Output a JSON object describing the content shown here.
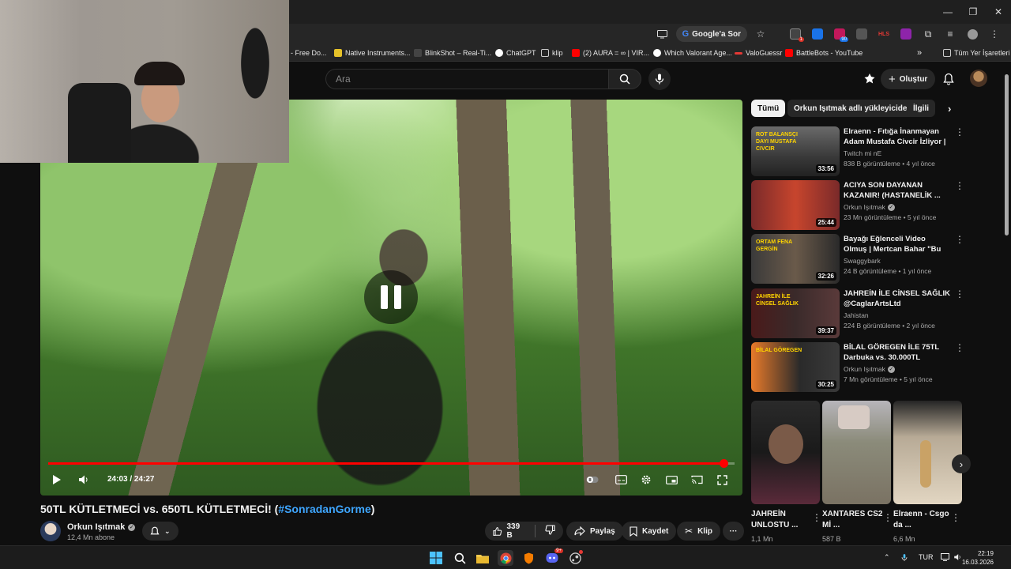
{
  "browser": {
    "window_controls": [
      "—",
      "❐",
      "✕"
    ],
    "omnibox_actions": {
      "google_ask": "Google'a Sor"
    },
    "bookmarks": [
      {
        "label": "- Free Do..."
      },
      {
        "label": "Native Instruments..."
      },
      {
        "label": "BlinkShot – Real-Ti..."
      },
      {
        "label": "ChatGPT"
      },
      {
        "label": "klip"
      },
      {
        "label": "(2) AURA = ∞ | VIR..."
      },
      {
        "label": "Which Valorant Age..."
      },
      {
        "label": "ValoGuessr"
      },
      {
        "label": "BattleBots - YouTube"
      }
    ],
    "bookmarks_overflow": "»",
    "all_bookmarks": "Tüm Yer İşaretleri"
  },
  "header": {
    "search_placeholder": "Ara",
    "create_label": "Oluştur"
  },
  "player": {
    "time": "24:03 / 24:27",
    "progress_fraction": 0.984
  },
  "video": {
    "title_main": "50TL KÜTLETMECİ vs. 650TL KÜTLETMECİ! (",
    "title_tag": "#SonradanGorme",
    "title_end": ")",
    "channel": "Orkun Işıtmak",
    "subscribers": "12,4 Mn abone",
    "likes": "339 B",
    "share": "Paylaş",
    "save": "Kaydet",
    "clip": "Klip",
    "more": "···"
  },
  "chips": [
    "Tümü",
    "Orkun Işıtmak adlı yükleyiciden",
    "İlgili"
  ],
  "recommendations": [
    {
      "title": "Elraenn - Fıtığa İnanmayan Adam Mustafa Civcir İzliyor | ...",
      "channel": "Twitch mi nE",
      "verified": false,
      "meta": "838 B görüntüleme • 4 yıl önce",
      "duration": "33:56",
      "thumb_text": "ROT BALANSÇI DAYI MUSTAFA CIVCIR"
    },
    {
      "title": "ACIYA SON DAYANAN KAZANIR! (HASTANELİK ...",
      "channel": "Orkun Işıtmak",
      "verified": true,
      "meta": "23 Mn görüntüleme • 5 yıl önce",
      "duration": "25:44",
      "thumb_text": ""
    },
    {
      "title": "Bayağı Eğlenceli Video Olmuş | Mertcan Bahar \"Bu işin dönüş...",
      "channel": "Swaggybark",
      "verified": false,
      "meta": "24 B görüntüleme • 1 yıl önce",
      "duration": "32:26",
      "thumb_text": "ORTAM FENA GERGİN"
    },
    {
      "title": "JAHREİN İLE CİNSEL SAĞLIK @CaglarArtsLtd",
      "channel": "Jahistan",
      "verified": false,
      "meta": "224 B görüntüleme • 2 yıl önce",
      "duration": "39:37",
      "thumb_text": "JAHREİN İLE CİNSEL SAĞLIK"
    },
    {
      "title": "BİLAL GÖREGEN İLE 75TL Darbuka vs. 30.000TL Darbuk...",
      "channel": "Orkun Işıtmak",
      "verified": true,
      "meta": "7 Mn görüntüleme • 5 yıl önce",
      "duration": "30:25",
      "thumb_text": "BİLAL GÖREGEN"
    }
  ],
  "shorts": [
    {
      "title": "JAHREİN UNLOSTU ...",
      "views": "1,1 Mn"
    },
    {
      "title": "XANTARES CS2 Mİ ...",
      "views": "587 B"
    },
    {
      "title": "Elraenn - Csgo da ...",
      "views": "6,6 Mn"
    }
  ],
  "taskbar": {
    "lang": "TUR",
    "time": "22:19",
    "date": "16.03.2026",
    "discord_badge": "9+"
  },
  "colors": {
    "progress": "#ff0000",
    "link": "#3ea6ff",
    "background": "#0f0f0f"
  }
}
